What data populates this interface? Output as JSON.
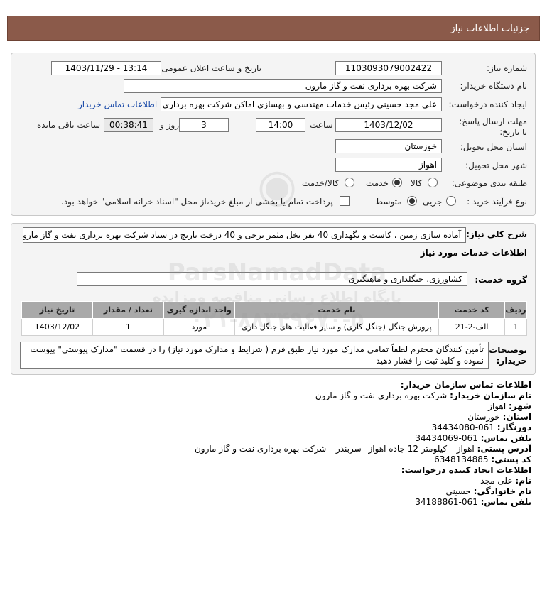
{
  "header": {
    "title": "جزئیات اطلاعات نیاز"
  },
  "form": {
    "need_number_label": "شماره نیاز:",
    "need_number": "1103093079002422",
    "announce_label": "تاریخ و ساعت اعلان عمومی:",
    "announce_value": "1403/11/29 - 13:14",
    "buyer_org_label": "نام دستگاه خریدار:",
    "buyer_org": "شرکت بهره برداری نفت و گاز مارون",
    "creator_label": "ایجاد کننده درخواست:",
    "creator": "علی مجد حسینی رئیس خدمات مهندسی و بهسازی اماکن شرکت بهره برداری",
    "contact_link": "اطلاعات تماس خریدار",
    "deadline_label": "مهلت ارسال پاسخ: تا تاریخ:",
    "deadline_date": "1403/12/02",
    "time_label": "ساعت",
    "deadline_time": "14:00",
    "days_value": "3",
    "days_label": "روز و",
    "remaining_time": "00:38:41",
    "remaining_label": "ساعت باقی مانده",
    "province_label": "استان محل تحویل:",
    "province": "خوزستان",
    "city_label": "شهر محل تحویل:",
    "city": "اهواز",
    "category_label": "طبقه بندی موضوعی:",
    "category_options": [
      "کالا",
      "خدمت",
      "کالا/خدمت"
    ],
    "process_label": "نوع فرآیند خرید :",
    "process_options": [
      "جزیی",
      "متوسط"
    ],
    "payment_note": "پرداخت تمام یا بخشی از مبلغ خرید،از محل \"اسناد خزانه اسلامی\" خواهد بود."
  },
  "summary": {
    "label": "شرح کلی نیاز:",
    "text": "آماده سازی زمین ، کاشت و نگهداری 40 نفر نخل مثمر برحی و 40 درخت نارنج در ستاد شرکت بهره برداری نفت و گاز مارون",
    "services_title": "اطلاعات خدمات مورد نیاز",
    "service_group_label": "گروه خدمت:",
    "service_group": "کشاورزی، جنگلداری و ماهیگیری"
  },
  "table": {
    "headers": [
      "ردیف",
      "کد خدمت",
      "نام خدمت",
      "واحد اندازه گیری",
      "تعداد / مقدار",
      "تاریخ نیاز"
    ],
    "rows": [
      [
        "1",
        "الف-2-21",
        "پرورش جنگل (جنگل کاری) و سایر فعالیت های جنگل داری",
        "مورد",
        "1",
        "1403/12/02"
      ]
    ]
  },
  "notes": {
    "label": "توضیحات خریدار:",
    "text": "تأمین کنندگان محترم لطفاً تمامی مدارک مورد نیاز طبق فرم ( شرایط و مدارک مورد نیاز) را در قسمت \"مدارک پیوستی\" پیوست نموده و کلید ثبت را فشار دهید"
  },
  "contact": {
    "title": "اطلاعات تماس سازمان خریدار:",
    "org_label": "نام سازمان خریدار:",
    "org": "شرکت بهره برداری نفت و گاز مارون",
    "city_label": "شهر:",
    "city": "اهواز",
    "province_label": "استان:",
    "province": "خوزستان",
    "fax_label": "دورنگار:",
    "fax": "061-34434080",
    "phone_label": "تلفن تماس:",
    "phone": "061-34434069",
    "address_label": "آدرس پستی:",
    "address": "اهواز – کیلومتر 12 جاده اهواز –سربندر – شرکت بهره برداری نفت و گاز مارون",
    "postal_label": "کد پستی:",
    "postal": "6348134885",
    "creator_title": "اطلاعات ایجاد کننده درخواست:",
    "name_label": "نام:",
    "name": "علی مجد",
    "family_label": "نام خانوادگی:",
    "family": "حسینی",
    "creator_phone_label": "تلفن تماس:",
    "creator_phone": "061-34188861"
  },
  "watermark": {
    "line1": "ParsNamadData",
    "line2": "پایگاه اطلاع رسانی مناقصه ومزایده",
    "line3": "۰۲۱-۸۸۳۴۹۶۷۰-۵"
  }
}
